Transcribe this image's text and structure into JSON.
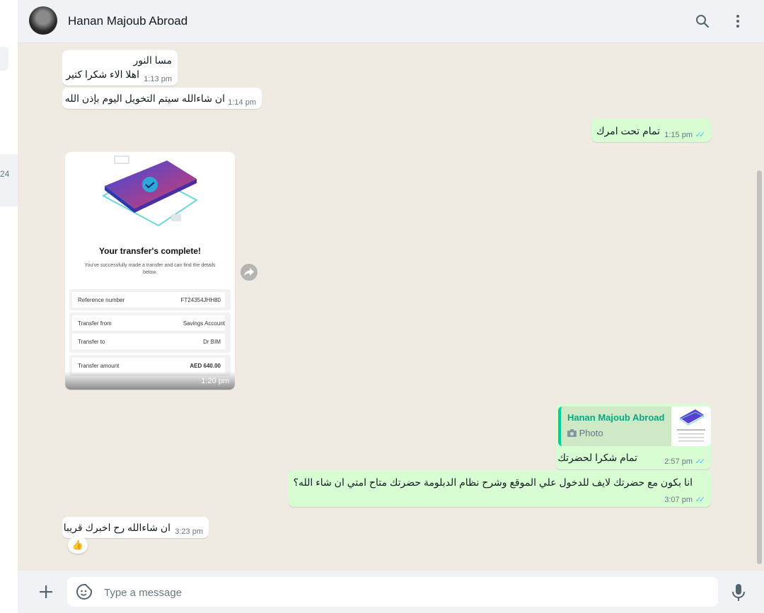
{
  "header": {
    "contact_name": "Hanan Majoub Abroad",
    "icons": [
      "search-icon",
      "menu-icon"
    ]
  },
  "left_panel": {
    "partial_text": "24"
  },
  "messages": [
    {
      "direction": "in",
      "lines": [
        "مسا النور",
        "اهلا الاء شكرا كتير"
      ],
      "time": "1:13 pm"
    },
    {
      "direction": "in",
      "text": "ان شاءالله سيتم التخويل اليوم بإذن الله",
      "time": "1:14 pm"
    },
    {
      "direction": "out",
      "text": "تمام تحت امرك",
      "time": "1:15 pm"
    },
    {
      "direction": "in",
      "type": "image",
      "time": "1:20 pm"
    },
    {
      "direction": "out",
      "quoted": {
        "author": "Hanan Majoub Abroad",
        "type": "Photo"
      },
      "text": "تمام شكرا لحضرتك",
      "time": "2:57 pm"
    },
    {
      "direction": "out",
      "text": "انا بكون مع حضرتك لايف للدخول علي الموقع وشرح نظام الدبلومة حضرتك متاح امتي ان شاء الله؟",
      "time": "3:07 pm"
    },
    {
      "direction": "in",
      "text": "ان شاءالله رح اخبرك قريبا",
      "time": "3:23 pm",
      "reaction": "👍"
    }
  ],
  "receipt_image": {
    "title": "Your transfer's complete!",
    "subtitle": "You've successfully made a transfer and can find the details below.",
    "rows": [
      {
        "label": "Reference number",
        "value": "FT24354JHH80"
      },
      {
        "label": "Transfer from",
        "value": "Savings Account"
      },
      {
        "label": "Transfer to",
        "value": "Dr BIM"
      },
      {
        "label": "Transfer amount",
        "value": "AED 640.00"
      }
    ]
  },
  "composer": {
    "placeholder": "Type a message"
  },
  "colors": {
    "incoming": "#ffffff",
    "outgoing": "#d9fdd3",
    "background": "#efeae2",
    "header": "#f0f2f5",
    "accent": "#06a884",
    "read_ticks": "#53bdeb"
  }
}
